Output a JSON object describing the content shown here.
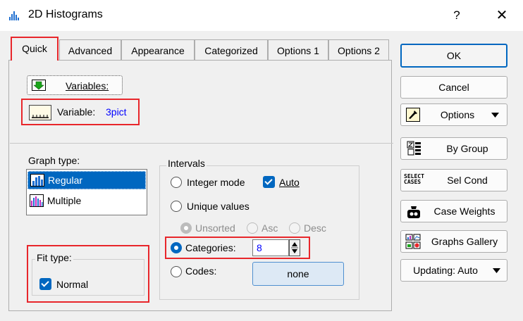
{
  "window": {
    "title": "2D Histograms",
    "help_glyph": "?",
    "close_glyph": "✕"
  },
  "tabs": [
    {
      "label": "Quick"
    },
    {
      "label": "Advanced"
    },
    {
      "label": "Appearance"
    },
    {
      "label": "Categorized"
    },
    {
      "label": "Options 1"
    },
    {
      "label": "Options 2"
    }
  ],
  "variables_button": {
    "label": "Variables:"
  },
  "variable": {
    "label": "Variable:",
    "value": "3pict"
  },
  "graph_type": {
    "label": "Graph type:",
    "items": [
      {
        "label": "Regular",
        "selected": true
      },
      {
        "label": "Multiple",
        "selected": false
      }
    ]
  },
  "intervals": {
    "label": "Intervals",
    "integer_mode": "Integer mode",
    "auto": "Auto",
    "unique_values": "Unique values",
    "unsorted": "Unsorted",
    "asc": "Asc",
    "desc": "Desc",
    "categories_label": "Categories:",
    "categories_value": "8",
    "codes_label": "Codes:",
    "codes_button": "none"
  },
  "fit_type": {
    "label": "Fit type:",
    "normal": "Normal"
  },
  "side_buttons": {
    "ok": "OK",
    "cancel": "Cancel",
    "options": "Options",
    "by_group": "By Group",
    "sel_cond": "Sel Cond",
    "sel_cond_icon_text": "SELECT CASES",
    "case_weights": "Case Weights",
    "graphs_gallery": "Graphs Gallery",
    "updating": "Updating: Auto"
  },
  "colors": {
    "accent": "#0067c0",
    "highlight": "#e8262b",
    "link_blue": "#0000ff"
  }
}
